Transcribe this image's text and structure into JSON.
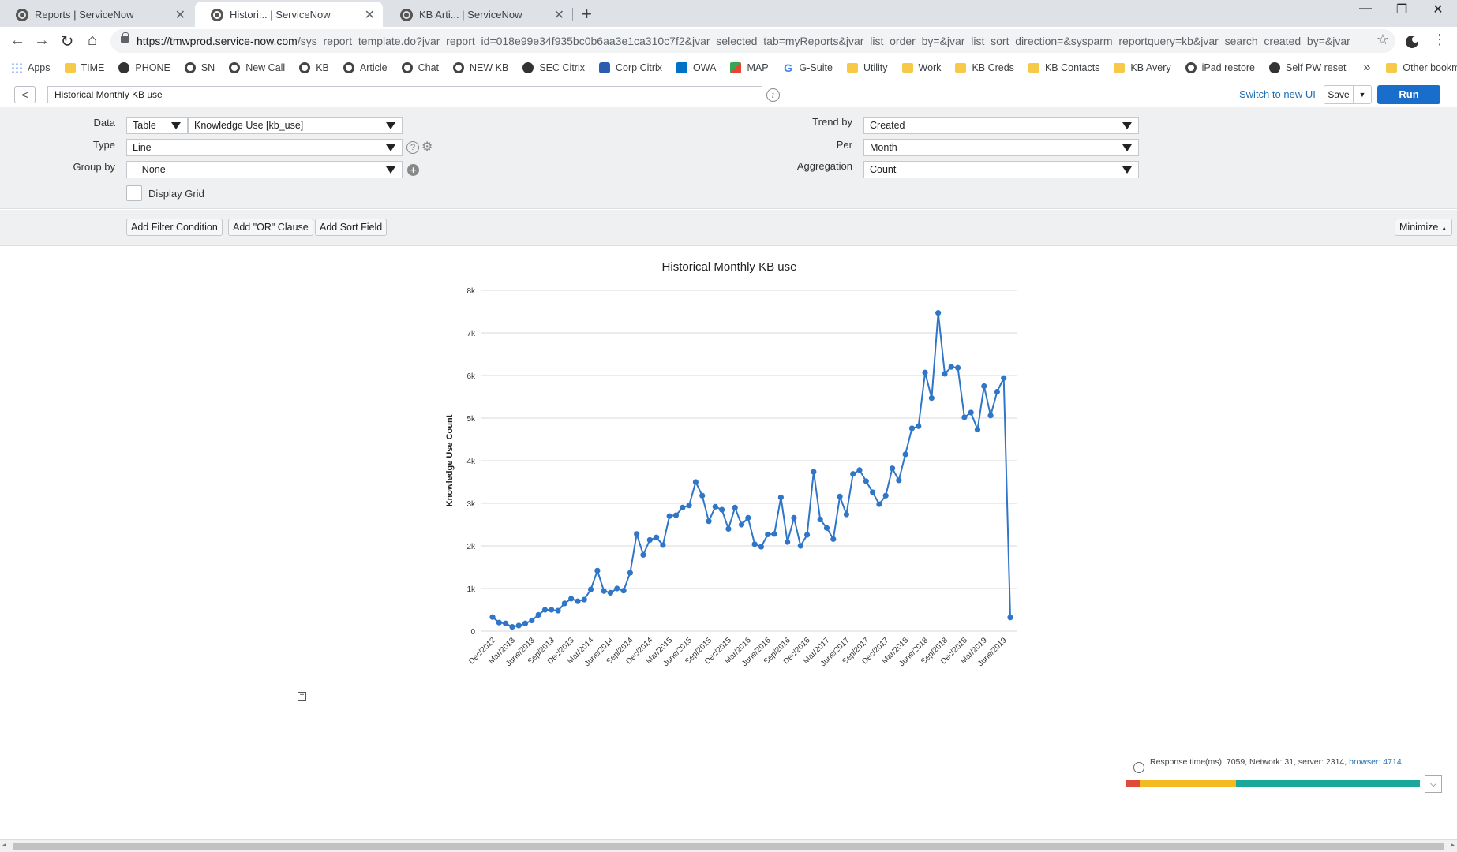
{
  "browser": {
    "tabs": [
      {
        "title": "Reports | ServiceNow",
        "active": false
      },
      {
        "title": "Histori... | ServiceNow",
        "active": true
      },
      {
        "title": "KB Arti... | ServiceNow",
        "active": false
      }
    ],
    "url_host": "https://tmwprod.service-now.com",
    "url_rest": "/sys_report_template.do?jvar_report_id=018e99e34f935bc0b6aa3e1ca310c7f2&jvar_selected_tab=myReports&jvar_list_order_by=&jvar_list_sort_direction=&sysparm_reportquery=kb&jvar_search_created_by=&jvar_se...",
    "bookmarks": [
      {
        "label": "Apps",
        "icon": "grid-icon"
      },
      {
        "label": "TIME",
        "icon": "folder-icon"
      },
      {
        "label": "PHONE",
        "icon": "globe-icon"
      },
      {
        "label": "SN",
        "icon": "servicenow-icon"
      },
      {
        "label": "New Call",
        "icon": "servicenow-icon"
      },
      {
        "label": "KB",
        "icon": "servicenow-icon"
      },
      {
        "label": "Article",
        "icon": "servicenow-icon"
      },
      {
        "label": "Chat",
        "icon": "servicenow-icon"
      },
      {
        "label": "NEW KB",
        "icon": "servicenow-icon"
      },
      {
        "label": "SEC Citrix",
        "icon": "globe-icon"
      },
      {
        "label": "Corp Citrix",
        "icon": "citrix-icon"
      },
      {
        "label": "OWA",
        "icon": "outlook-icon"
      },
      {
        "label": "MAP",
        "icon": "maps-icon"
      },
      {
        "label": "G-Suite",
        "icon": "google-icon"
      },
      {
        "label": "Utility",
        "icon": "folder-icon"
      },
      {
        "label": "Work",
        "icon": "folder-icon"
      },
      {
        "label": "KB Creds",
        "icon": "folder-icon"
      },
      {
        "label": "KB Contacts",
        "icon": "folder-icon"
      },
      {
        "label": "KB Avery",
        "icon": "folder-icon"
      },
      {
        "label": "iPad restore",
        "icon": "servicenow-icon"
      },
      {
        "label": "Self PW reset",
        "icon": "globe-icon"
      }
    ],
    "bookmarks_more": "»",
    "other_bookmarks": "Other bookmarks"
  },
  "report": {
    "title_value": "Historical Monthly KB use",
    "switch_ui": "Switch to new UI",
    "save_label": "Save",
    "run_label": "Run"
  },
  "config": {
    "data_label": "Data",
    "data_source": "Table",
    "data_table": "Knowledge Use [kb_use]",
    "type_label": "Type",
    "type_value": "Line",
    "group_label": "Group by",
    "group_value": "-- None --",
    "display_grid_label": "Display Grid",
    "trend_label": "Trend by",
    "trend_value": "Created",
    "per_label": "Per",
    "per_value": "Month",
    "agg_label": "Aggregation",
    "agg_value": "Count"
  },
  "filters": {
    "add_filter": "Add Filter Condition",
    "add_or": "Add \"OR\" Clause",
    "add_sort": "Add Sort Field",
    "minimize": "Minimize"
  },
  "response": {
    "text": "Response time(ms): 7059, Network: 31, server: 2314,",
    "browser_text": "browser: 4714",
    "segments": [
      {
        "ms": 31,
        "color": "#e04a3b"
      },
      {
        "ms": 2314,
        "color": "#f5b921"
      },
      {
        "ms": 4714,
        "color": "#1aa89b"
      }
    ]
  },
  "chart_data": {
    "type": "line",
    "title": "Historical Monthly KB use",
    "ylabel": "Knowledge Use Count",
    "xlabel": "",
    "ylim": [
      0,
      8000
    ],
    "yticks": [
      "0",
      "1k",
      "2k",
      "3k",
      "4k",
      "5k",
      "6k",
      "7k",
      "8k"
    ],
    "xtick_labels": [
      "Dec/2012",
      "Mar/2013",
      "June/2013",
      "Sep/2013",
      "Dec/2013",
      "Mar/2014",
      "June/2014",
      "Sep/2014",
      "Dec/2014",
      "Mar/2015",
      "June/2015",
      "Sep/2015",
      "Dec/2015",
      "Mar/2016",
      "June/2016",
      "Sep/2016",
      "Dec/2016",
      "Mar/2017",
      "June/2017",
      "Sep/2017",
      "Dec/2017",
      "Mar/2018",
      "June/2018",
      "Sep/2018",
      "Dec/2018",
      "Mar/2019",
      "June/2019"
    ],
    "color": "#2f75c8",
    "grid": true,
    "values": [
      330,
      200,
      180,
      100,
      130,
      180,
      250,
      380,
      500,
      500,
      480,
      650,
      760,
      700,
      740,
      980,
      1420,
      940,
      900,
      1000,
      950,
      1370,
      2280,
      1790,
      2140,
      2200,
      2020,
      2700,
      2720,
      2900,
      2950,
      3500,
      3180,
      2580,
      2920,
      2850,
      2400,
      2900,
      2500,
      2660,
      2040,
      1980,
      2270,
      2280,
      3140,
      2090,
      2660,
      2000,
      2260,
      3740,
      2620,
      2420,
      2160,
      3160,
      2740,
      3690,
      3780,
      3520,
      3260,
      2980,
      3180,
      3820,
      3540,
      4150,
      4760,
      4810,
      6070,
      5470,
      7470,
      6040,
      6200,
      6180,
      5020,
      5130,
      4730,
      5750,
      5060,
      5620,
      5940,
      320
    ]
  }
}
